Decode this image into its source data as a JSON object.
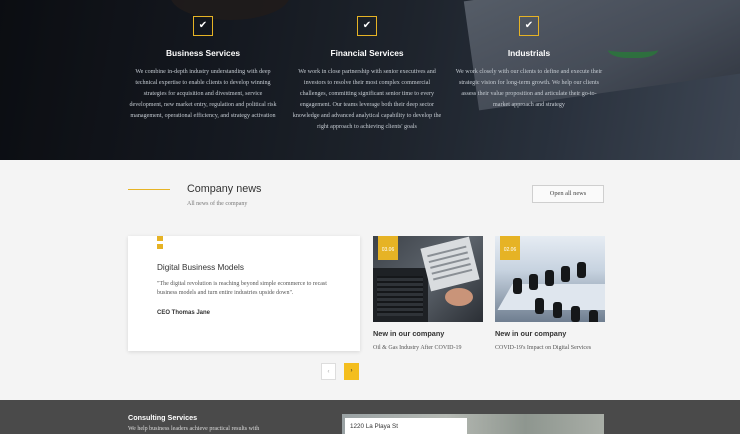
{
  "services": [
    {
      "title": "Business Services",
      "desc": "We combine in-depth industry understanding with deep technical expertise to enable clients to develop winning strategies for acquisition and divestment, service development, new market entry, regulation and political risk management, operational efficiency, and strategy activation",
      "icon": "check-icon"
    },
    {
      "title": "Financial Services",
      "desc": "We work in close partnership with senior executives and investors to resolve their most complex commercial challenges, committing significant senior time to every engagement. Our teams leverage both their deep sector knowledge and advanced analytical capability to develop the right approach to achieving clients' goals",
      "icon": "check-icon"
    },
    {
      "title": "Industrials",
      "desc": "We work closely with our clients to define and execute their strategic vision for long-term growth. We help our clients assess their value proposition and articulate their go-to-market approach and strategy",
      "icon": "check-icon"
    }
  ],
  "news": {
    "title": "Company news",
    "subtitle": "All news of the company",
    "open_all": "Open all news",
    "quote": {
      "title": "Digital Business Models",
      "text": "\"The digital revolution is reaching beyond simple ecommerce to recast business models and turn entire industries upside down\".",
      "author": "CEO Thomas Jane"
    },
    "cards": [
      {
        "date": "03.06",
        "title": "New in our company",
        "desc": "Oil & Gas Industry After COVID-19"
      },
      {
        "date": "02.06",
        "title": "New in our company",
        "desc": "COVID-19's Impact on Digital Services"
      }
    ],
    "pager": {
      "prev": "‹",
      "next": "›"
    }
  },
  "footer": {
    "title": "Consulting Services",
    "desc": "We help business leaders achieve practical results with",
    "map_address": "1220 La Playa St"
  },
  "colors": {
    "accent": "#e6b325",
    "pager_active": "#f4be1e",
    "footer_bg": "#4a4a4a"
  }
}
